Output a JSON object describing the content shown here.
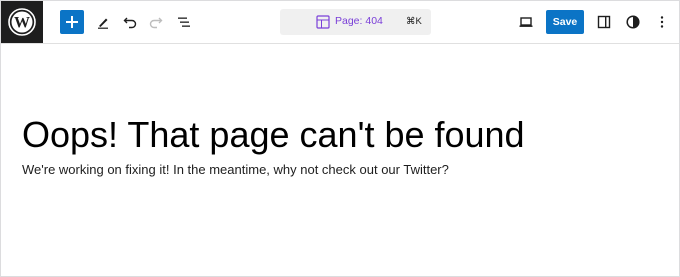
{
  "toolbar": {
    "logo_icon": "wordpress-logo-icon",
    "icons": [
      "plus-icon",
      "pencil-icon",
      "undo-icon",
      "redo-icon",
      "list-view-icon",
      "desktop-preview-icon",
      "sidebar-toggle-icon",
      "styles-contrast-icon",
      "more-options-icon"
    ],
    "command_bar": {
      "title": "Page: 404",
      "shortcut": "⌘K",
      "icon": "page-layout-icon"
    },
    "save_label": "Save",
    "accent_color": "#0b74c6",
    "title_color": "#7a3fd8"
  },
  "content": {
    "heading": "Oops! That page can't be found",
    "body": "We're working on fixing it! In the meantime, why not check out our Twitter?"
  }
}
